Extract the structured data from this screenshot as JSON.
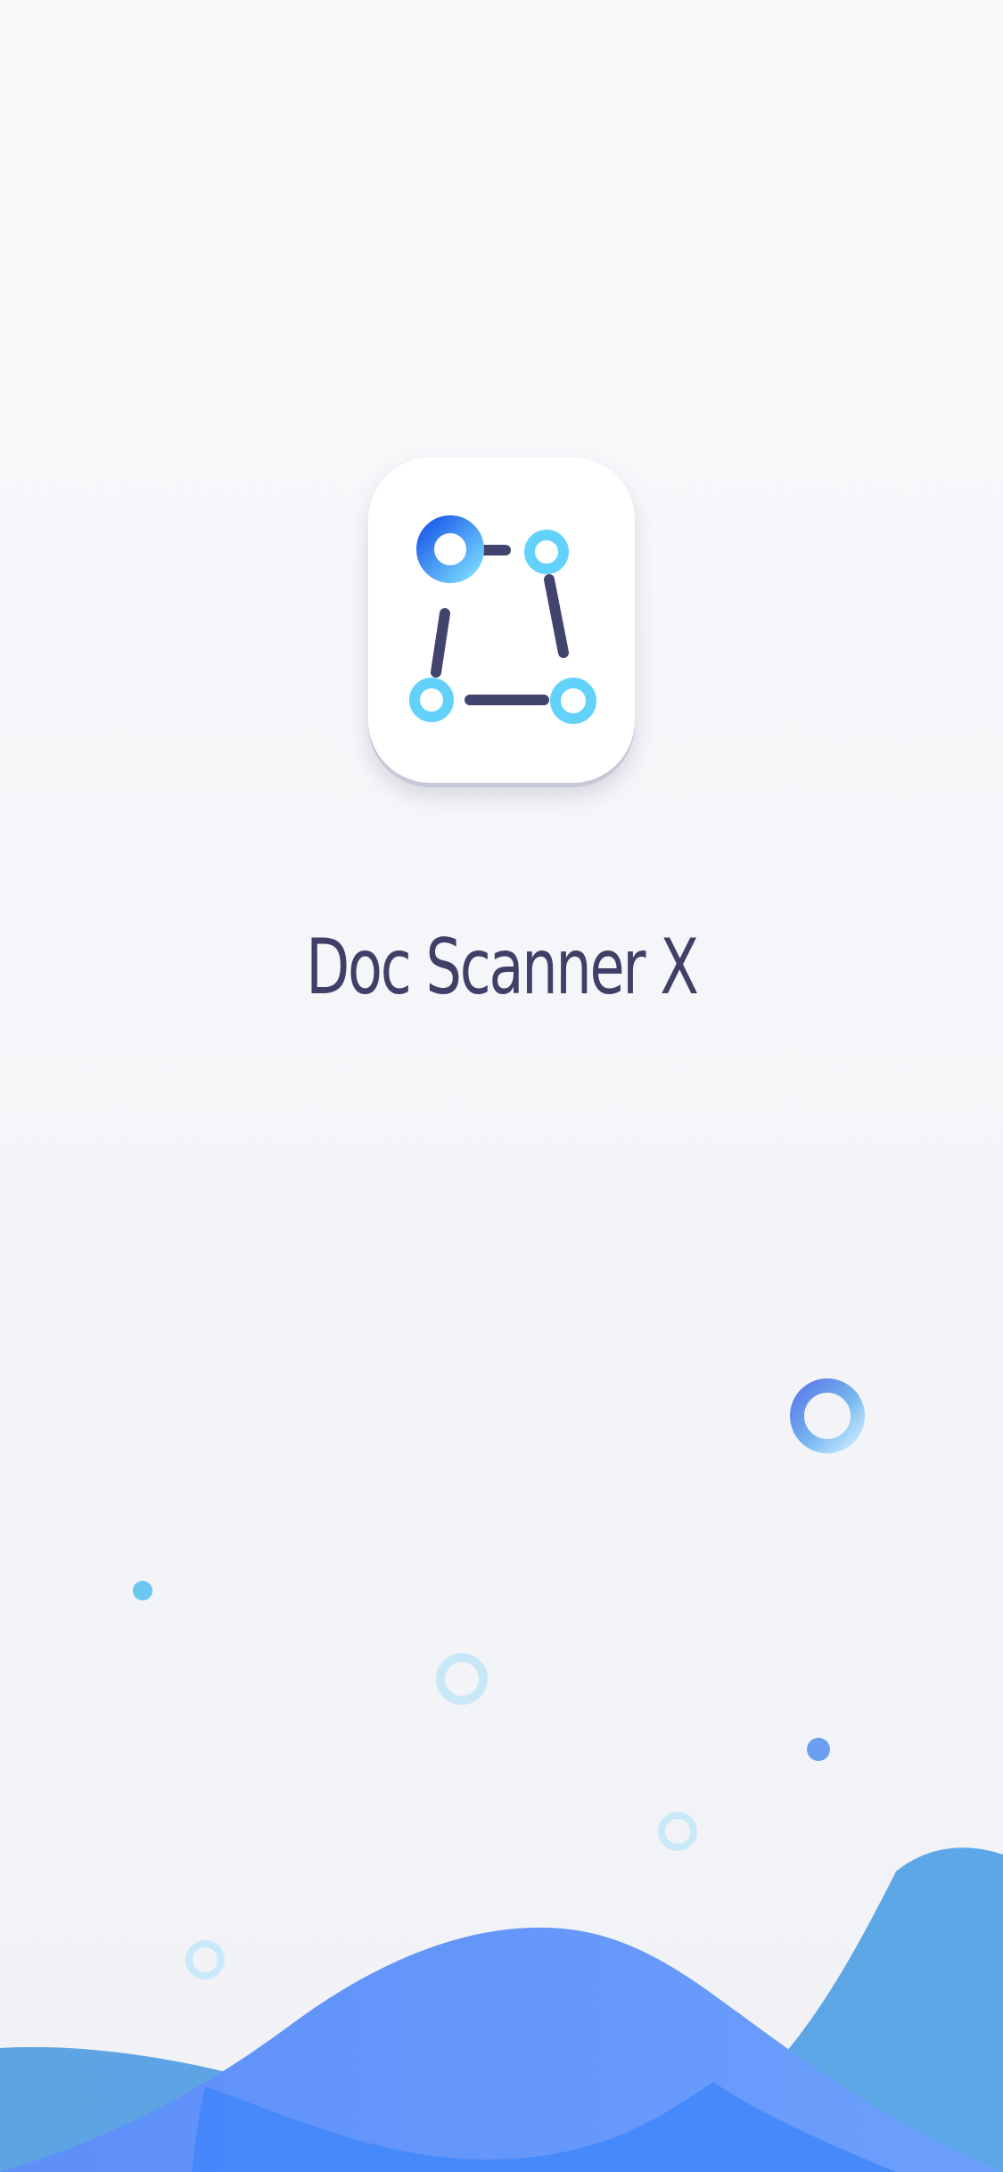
{
  "splash": {
    "app_name": "Doc Scanner X",
    "logo_icon": "document-scanner-corners-icon"
  },
  "colors": {
    "background_top": "#f8f9fb",
    "background_bottom": "#f1f2f6",
    "title": "#403f67",
    "icon_line": "#41446d",
    "icon_ring_light": "#5ed4ff",
    "icon_ring_dark": "#2569f4",
    "wave_front": "#5c9dff",
    "wave_back": "#67a7ea",
    "wave_deep": "#4488fb"
  },
  "decorations": {
    "bubble_icon": "bubble-ring-icon",
    "dot_icon": "bubble-dot-icon",
    "wave_icon": "blue-wave-background"
  }
}
